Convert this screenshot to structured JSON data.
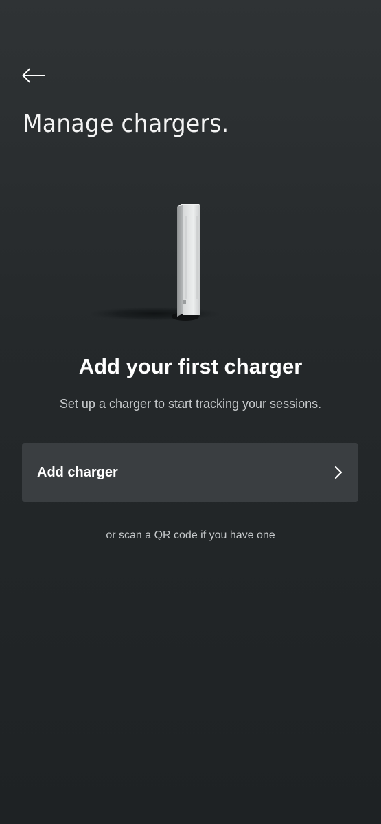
{
  "header": {
    "back_icon": "arrow-left-icon",
    "title": "Manage chargers."
  },
  "empty_state": {
    "illustration": "wall-charger-illustration",
    "title": "Add your first charger",
    "subtitle": "Set up a charger to start tracking your sessions."
  },
  "actions": {
    "add_charger_label": "Add charger",
    "add_charger_icon": "chevron-right-icon",
    "qr_hint": "or scan a QR code if you have one"
  }
}
